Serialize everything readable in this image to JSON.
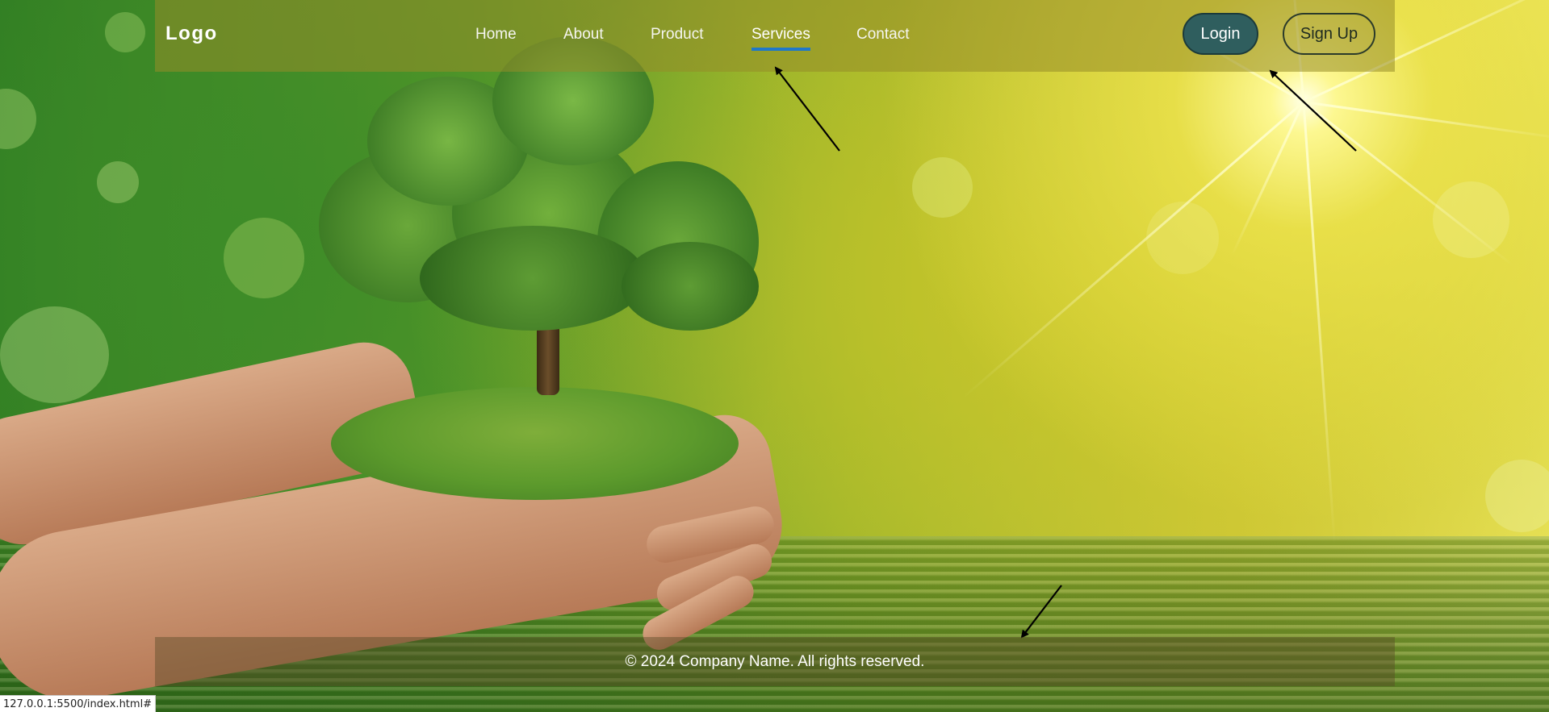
{
  "header": {
    "logo": "Logo",
    "nav": [
      {
        "label": "Home",
        "active": false
      },
      {
        "label": "About",
        "active": false
      },
      {
        "label": "Product",
        "active": false
      },
      {
        "label": "Services",
        "active": true
      },
      {
        "label": "Contact",
        "active": false
      }
    ],
    "login_label": "Login",
    "signup_label": "Sign Up"
  },
  "footer": {
    "copyright": "© 2024 Company Name. All rights reserved."
  },
  "status_bar": {
    "url": "127.0.0.1:5500/index.html#"
  },
  "colors": {
    "nav_active_underline": "#1f78c8",
    "login_bg": "#2f5e5e",
    "header_bg": "rgba(150,140,40,0.55)"
  }
}
